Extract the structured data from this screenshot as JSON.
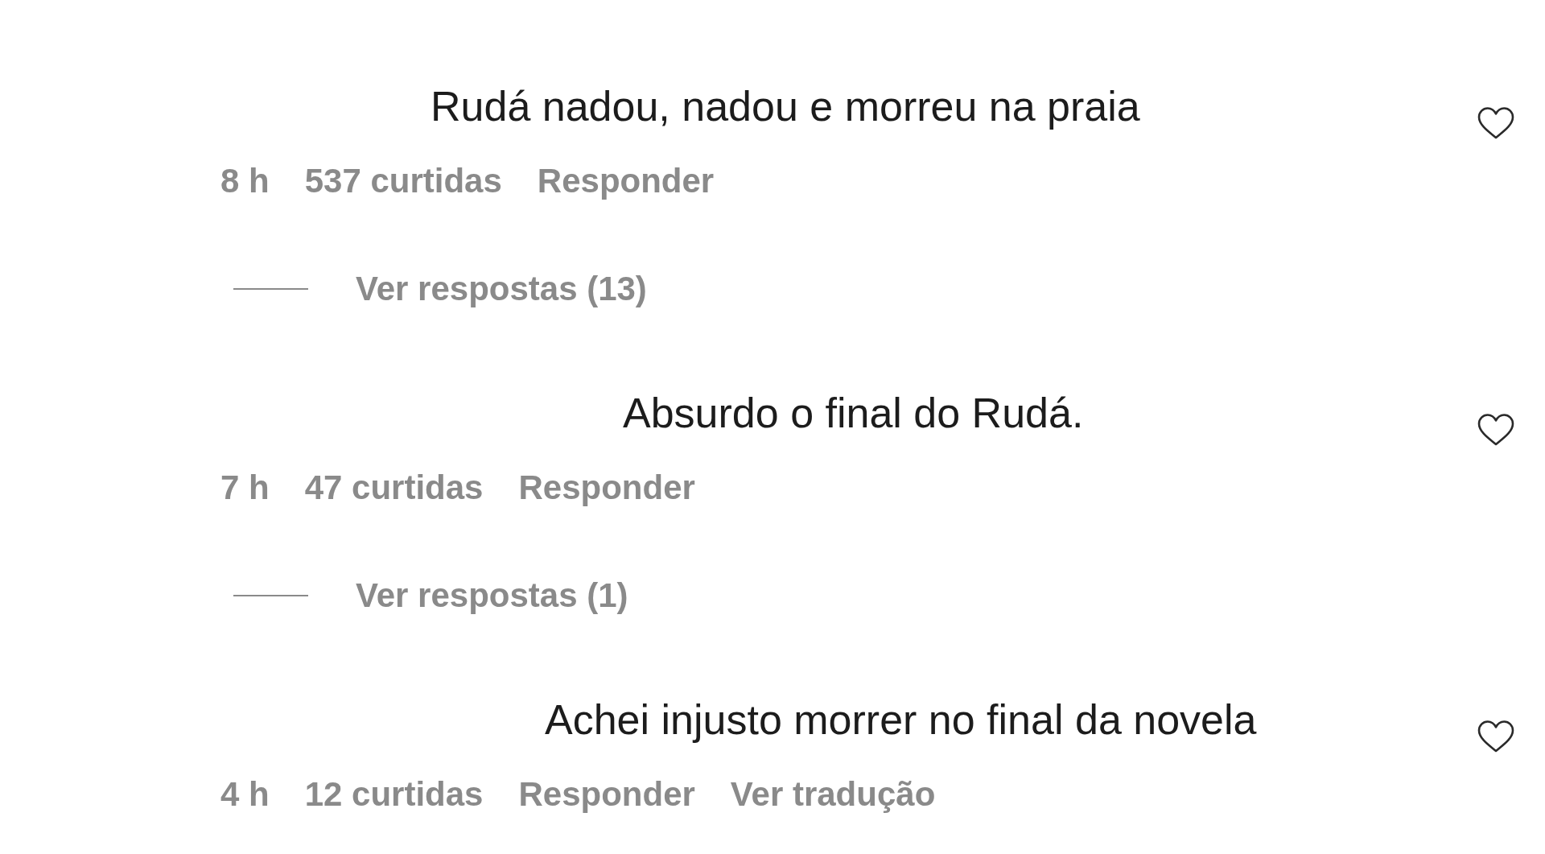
{
  "comments": [
    {
      "text": "Rudá nadou, nadou e morreu na praia",
      "liked": false,
      "time": "8 h",
      "likes": "537 curtidas",
      "actions": [
        "Responder"
      ],
      "view_replies": "Ver respostas (13)"
    },
    {
      "text": "Absurdo o final do Rudá.",
      "liked": false,
      "time": "7 h",
      "likes": "47 curtidas",
      "actions": [
        "Responder"
      ],
      "view_replies": "Ver respostas (1)"
    },
    {
      "text": "Achei injusto morrer no final da novela",
      "liked": false,
      "time": "4 h",
      "likes": "12 curtidas",
      "actions": [
        "Responder",
        "Ver tradução"
      ]
    }
  ]
}
